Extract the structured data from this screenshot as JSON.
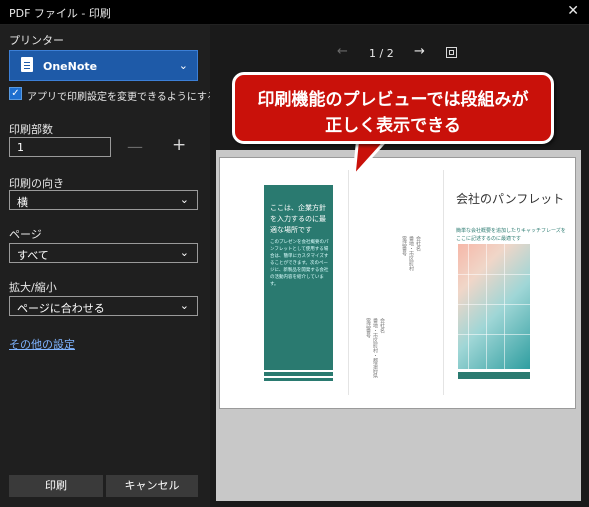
{
  "window": {
    "title": "PDF ファイル - 印刷",
    "close_glyph": "✕"
  },
  "printer": {
    "label": "プリンター",
    "selected": "OneNote",
    "icon": "onenote-icon"
  },
  "allow_app_settings": {
    "checked": true,
    "label": "アプリで印刷設定を変更できるようにする"
  },
  "copies": {
    "label": "印刷部数",
    "value": "1",
    "minus": "—",
    "plus": "+"
  },
  "orientation": {
    "label": "印刷の向き",
    "value": "横"
  },
  "pages": {
    "label": "ページ",
    "value": "すべて"
  },
  "scale": {
    "label": "拡大/縮小",
    "value": "ページに合わせる"
  },
  "more_settings": "その他の設定",
  "buttons": {
    "print": "印刷",
    "cancel": "キャンセル"
  },
  "preview_nav": {
    "prev": "←",
    "page": "1 / 2",
    "next": "→"
  },
  "callout": {
    "line1": "印刷機能のプレビューでは段組みが",
    "line2": "正しく表示できる"
  },
  "brochure": {
    "panel_heading": "ここは、企業方針を入力するのに最適な場所です",
    "panel_body": "このプレゼンを会社概要のパンフレットとして使用する場合は、簡単にカスタマイズすることができます。次のページに、新製品を開発する会社の活動内容を紹介しています。",
    "company_title": "会社のパンフレット",
    "company_subtitle": "簡単な会社概要を追加したりキャッチフレーズをここに記述するのに最適です",
    "col_mid_lines": [
      "会社名",
      "番地・市区町村",
      "電話番号"
    ],
    "col_left_lines": [
      "会社名",
      "番地・市区町村・都道府県",
      "電話番号"
    ]
  },
  "colors": {
    "accent": "#1e5aa8",
    "teal": "#2a7a70",
    "callout": "#c9110a"
  }
}
